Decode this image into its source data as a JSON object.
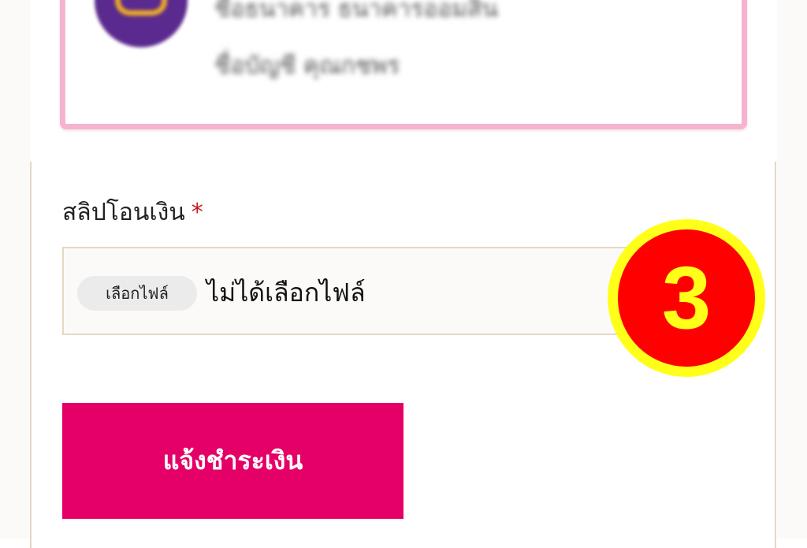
{
  "bank": {
    "line1": "ชื่อธนาคาร  ธนาคารออมสิน",
    "line2": "ชื่อบัญชี  คุณกชพร"
  },
  "form": {
    "slip_label": "สลิปโอนเงิน",
    "required_mark": "*",
    "choose_file_label": "เลือกไฟล์",
    "no_file_text": "ไม่ได้เลือกไฟล์",
    "submit_label": "แจ้งชำระเงิน"
  },
  "step": {
    "number": "3",
    "badge_color": "#ff0000",
    "ring_color": "#ffff1a"
  },
  "colors": {
    "accent": "#e40066",
    "panel_border": "#f6b3cf",
    "card_border": "#e4d8c3"
  }
}
